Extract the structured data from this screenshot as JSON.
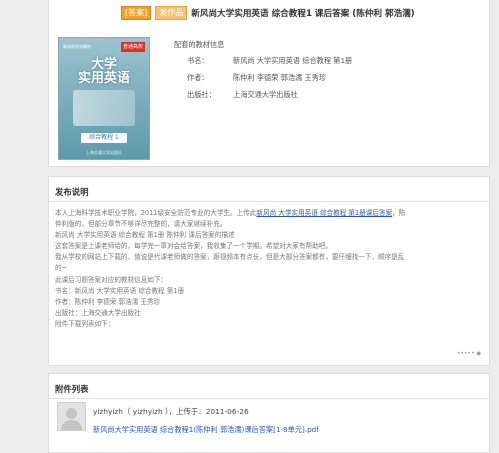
{
  "header": {
    "tag_answer": "[答案]",
    "tag_label": "发作品",
    "title": "新风尚大学实用英语 综合教程1 课后答案 (陈仲利 郭浩濡)"
  },
  "book_cover": {
    "series": "新风尚系列教材",
    "badge": "普通高校",
    "title_line1": "大学",
    "title_line2": "实用英语",
    "level": "综合教程 1",
    "publisher": "上海交通大学出版社"
  },
  "book_info": {
    "heading": "配套的教材信息",
    "rows": [
      {
        "label": "书名：",
        "value": "新风尚 大学实用英语 综合教程 第1册"
      },
      {
        "label": "作者：",
        "value": "陈仲利 李德荣 郭浩濡 王秀珍"
      },
      {
        "label": "出版社：",
        "value": "上海交通大学出版社"
      }
    ]
  },
  "release": {
    "title": "发布说明",
    "line1_pre": "本人上海科学技术职业学院，2011级安全防范专业的大学生。上传此",
    "line1_link": "新风尚 大学实用英语 综合教程 第1册课后答案",
    "line1_post": "，陈",
    "line2": "仲利版的，但部分章节不够详尽完整的，请大家继续补充。",
    "line3": "新风尚 大学实用英语 综合教程 第1册 陈仲利 课后答案的描述",
    "line4": "这套答案是上课老师给的，每学完一章对会给答案，我收集了一个学期。希望对大家有帮助吧。",
    "line5": "我从学校的网站上下载的，值说是代课老师做的答案，跟视频本有点长，但是大部分答案都有，要仔细找一下，顺序是乱",
    "line6": "的~",
    "line7": "此课后习题答案对应的教材信息如下：",
    "line8": "书名：新风尚 大学实用英语 综合教程 第1册",
    "line9": "作者：陈仲利 李德荣 郭浩濡 王秀珍",
    "line10": "出版社：上海交通大学出版社",
    "line11": "附件下载列表如下：",
    "more": "••••• ◆"
  },
  "attachments": {
    "title": "附件列表",
    "uploader_line": "yizhyizh（ yizhyizh ），上传于：2011-06-26",
    "file_name": "新风尚大学实用英语 综合教程1(陈仲利 郭浩濡)课后答案[1-8单元].pdf"
  },
  "colors": {
    "link": "#2b57c2",
    "tag_orange": "#f1a22c",
    "background": "#ececec"
  }
}
